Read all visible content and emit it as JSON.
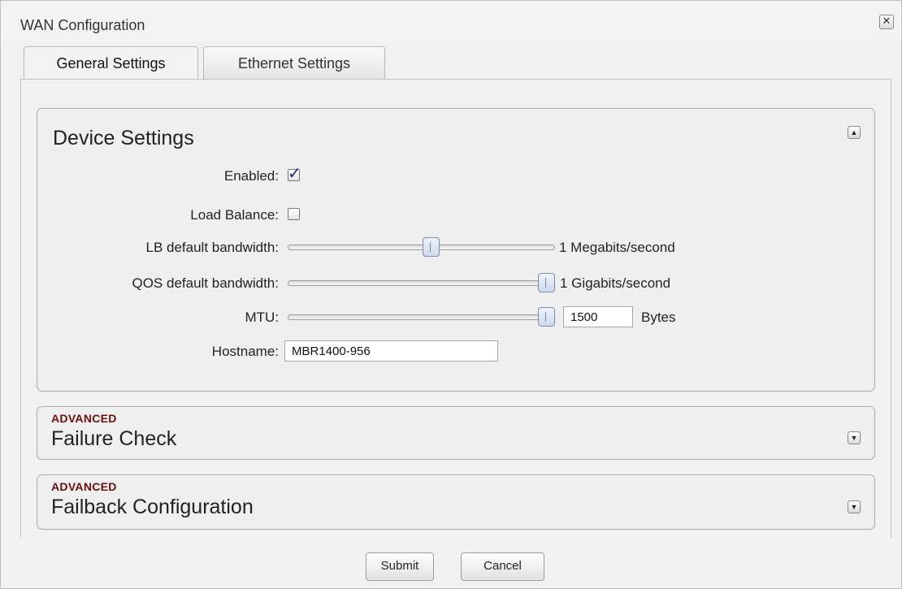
{
  "window": {
    "title": "WAN Configuration",
    "close_symbol": "✕"
  },
  "tabs": [
    {
      "label": "General Settings",
      "active": true
    },
    {
      "label": "Ethernet Settings",
      "active": false
    }
  ],
  "device_settings": {
    "title": "Device Settings",
    "collapse_symbol": "▲",
    "enabled": {
      "label": "Enabled:",
      "checked": true
    },
    "load_balance": {
      "label": "Load Balance:",
      "checked": false
    },
    "lb_bandwidth": {
      "label": "LB default bandwidth:",
      "value_text": "1 Megabits/second"
    },
    "qos_bandwidth": {
      "label": "QOS default bandwidth:",
      "value_text": "1 Gigabits/second"
    },
    "mtu": {
      "label": "MTU:",
      "value": "1500",
      "unit": "Bytes"
    },
    "hostname": {
      "label": "Hostname:",
      "value": "MBR1400-956"
    }
  },
  "failure_check": {
    "tag": "ADVANCED",
    "title": "Failure Check",
    "expand_symbol": "▼"
  },
  "failback": {
    "tag": "ADVANCED",
    "title": "Failback Configuration",
    "expand_symbol": "▼"
  },
  "buttons": {
    "submit": "Submit",
    "cancel": "Cancel"
  },
  "colors": {
    "advanced_tag": "#6b0f0f",
    "checkmark": "#1a2f6e",
    "slider_thumb": "#cfd9ea"
  }
}
